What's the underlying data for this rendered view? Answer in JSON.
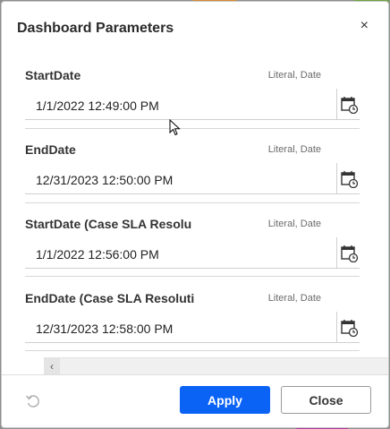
{
  "dialog": {
    "title": "Dashboard Parameters",
    "close_glyph": "×"
  },
  "parameters": [
    {
      "name": "StartDate",
      "type": "Literal, Date",
      "value": "1/1/2022 12:49:00 PM"
    },
    {
      "name": "EndDate",
      "type": "Literal, Date",
      "value": "12/31/2023 12:50:00 PM"
    },
    {
      "name": "StartDate (Case SLA Resolu",
      "type": "Literal, Date",
      "value": "1/1/2022 12:56:00 PM"
    },
    {
      "name": "EndDate (Case SLA Resoluti",
      "type": "Literal, Date",
      "value": "12/31/2023 12:58:00 PM"
    }
  ],
  "scroll": {
    "left_arrow": "‹",
    "up_arrow": "▲"
  },
  "footer": {
    "apply_label": "Apply",
    "close_label": "Close"
  },
  "icons": {
    "calendar": "calendar-icon",
    "reset": "reset-icon",
    "close": "close-icon"
  },
  "colors": {
    "accent": "#0b63f6",
    "backdrop": "#8f8f8f"
  }
}
